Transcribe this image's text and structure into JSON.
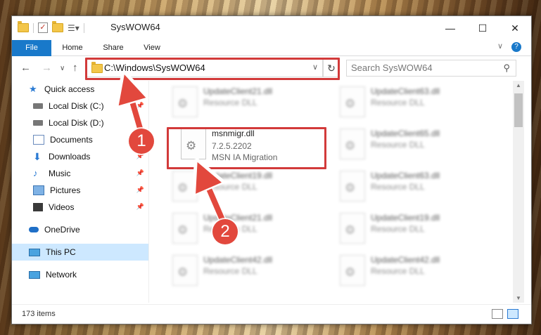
{
  "window": {
    "title": "SysWOW64",
    "minimize": "—",
    "maximize": "☐",
    "close": "✕"
  },
  "ribbon": {
    "tabs": [
      "File",
      "Home",
      "Share",
      "View"
    ],
    "help_chevron": "∨",
    "help": "?"
  },
  "address": {
    "path": "C:\\Windows\\SysWOW64",
    "search_placeholder": "Search SysWOW64",
    "dropdown_glyph": "∨",
    "refresh_glyph": "↻"
  },
  "nav": {
    "items": [
      {
        "label": "Quick access",
        "icon": "star-icon",
        "pinned": false
      },
      {
        "label": "Local Disk (C:)",
        "icon": "drive-icon",
        "pinned": true
      },
      {
        "label": "Local Disk (D:)",
        "icon": "drive-icon",
        "pinned": false
      },
      {
        "label": "Documents",
        "icon": "documents-icon",
        "pinned": true
      },
      {
        "label": "Downloads",
        "icon": "download-icon",
        "pinned": true
      },
      {
        "label": "Music",
        "icon": "music-icon",
        "pinned": true
      },
      {
        "label": "Pictures",
        "icon": "pictures-icon",
        "pinned": true
      },
      {
        "label": "Videos",
        "icon": "video-icon",
        "pinned": true
      },
      {
        "label": "OneDrive",
        "icon": "cloud-icon",
        "pinned": false
      },
      {
        "label": "This PC",
        "icon": "computer-icon",
        "pinned": false,
        "selected": true
      },
      {
        "label": "Network",
        "icon": "network-icon",
        "pinned": false
      }
    ]
  },
  "files": {
    "highlighted": {
      "name": "msnmigr.dll",
      "version": "7.2.5.2202",
      "description": "MSN IA Migration"
    },
    "col1": [
      {
        "name": "UpdateClient21.dll",
        "type": "Resource DLL"
      },
      {
        "name": "UpdateClient19.dll",
        "type": "Resource DLL"
      },
      {
        "name": "UpdateClient21.dll",
        "type": "Resource DLL"
      },
      {
        "name": "UpdateClient42.dll",
        "type": "Resource DLL"
      }
    ],
    "col2": [
      {
        "name": "UpdateClient63.dll",
        "type": "Resource DLL"
      },
      {
        "name": "UpdateClient65.dll",
        "type": "Resource DLL"
      },
      {
        "name": "UpdateClient63.dll",
        "type": "Resource DLL"
      },
      {
        "name": "UpdateClient19.dll",
        "type": "Resource DLL"
      },
      {
        "name": "UpdateClient42.dll",
        "type": "Resource DLL"
      }
    ]
  },
  "status": {
    "count": "173 items"
  },
  "callouts": {
    "one": "1",
    "two": "2"
  },
  "colors": {
    "accent": "#1979ca",
    "highlight": "#d23a3a",
    "callout": "#e2483d"
  }
}
